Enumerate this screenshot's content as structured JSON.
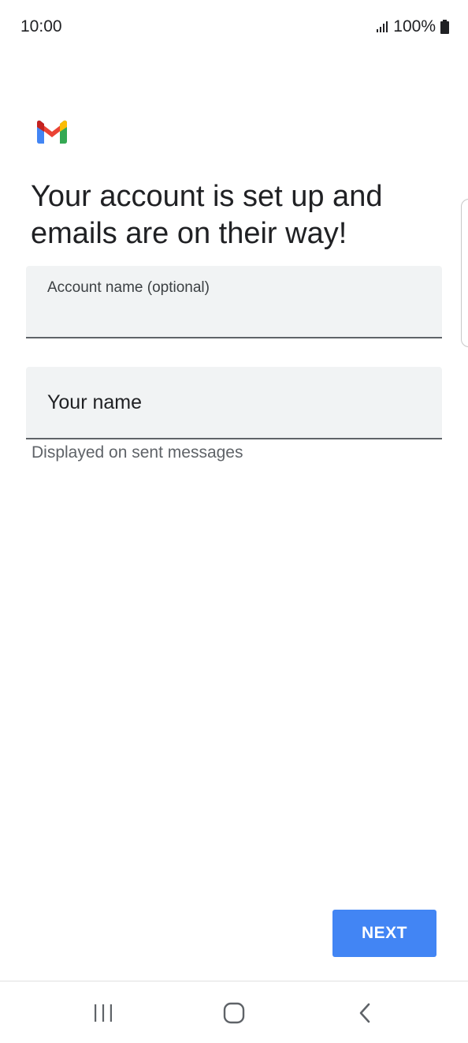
{
  "status_bar": {
    "time": "10:00",
    "battery": "100%",
    "icons": [
      "signal-icon",
      "battery-icon"
    ]
  },
  "app": {
    "logo": "gmail-logo",
    "colors": {
      "blue": "#4285F4",
      "red": "#EA4335",
      "yellow": "#FBBC04",
      "green": "#34A853"
    }
  },
  "headline": "Your account is set up and emails are on their way!",
  "form": {
    "account_name": {
      "label": "Account name (optional)",
      "value": ""
    },
    "your_name": {
      "placeholder": "Your name",
      "value": "",
      "helper": "Displayed on sent messages"
    }
  },
  "actions": {
    "next_label": "NEXT",
    "next_color": "#4285F4"
  },
  "nav_bar": {
    "icons": [
      "recents-icon",
      "home-icon",
      "back-icon"
    ]
  }
}
